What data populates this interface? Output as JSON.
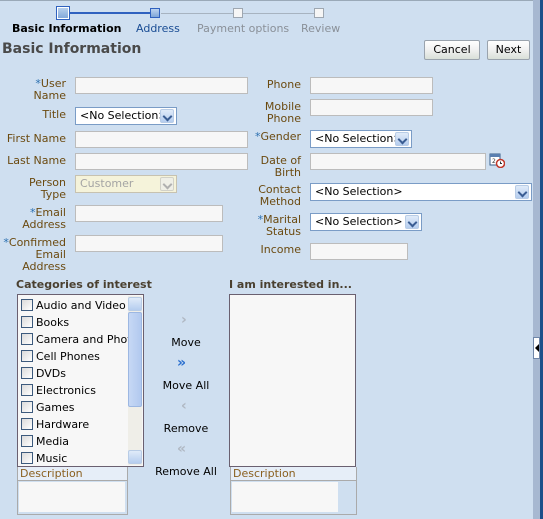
{
  "train": {
    "steps": [
      {
        "label": "Basic Information",
        "state": "current"
      },
      {
        "label": "Address",
        "state": "link"
      },
      {
        "label": "Payment options",
        "state": "disabled"
      },
      {
        "label": "Review",
        "state": "disabled"
      }
    ]
  },
  "page": {
    "title": "Basic Information",
    "cancel_label": "Cancel",
    "next_label": "Next"
  },
  "form": {
    "left": {
      "user_name": {
        "label_line1": "User",
        "label_line2": "Name",
        "required": "*",
        "value": ""
      },
      "title": {
        "label": "Title",
        "value": "<No Selection>"
      },
      "first_name": {
        "label": "First Name",
        "value": ""
      },
      "last_name": {
        "label": "Last Name",
        "value": ""
      },
      "person_type": {
        "label_line1": "Person",
        "label_line2": "Type",
        "value": "Customer"
      },
      "email": {
        "label_line1": "Email",
        "label_line2": "Address",
        "required": "*",
        "value": ""
      },
      "confirm_email": {
        "label_line1": "Confirmed",
        "label_line2": "Email",
        "label_line3": "Address",
        "required": "*",
        "value": ""
      }
    },
    "right": {
      "phone": {
        "label": "Phone",
        "value": ""
      },
      "mobile": {
        "label_line1": "Mobile",
        "label_line2": "Phone",
        "value": ""
      },
      "gender": {
        "label": "Gender",
        "required": "*",
        "value": "<No Selection>"
      },
      "dob": {
        "label_line1": "Date of",
        "label_line2": "Birth",
        "value": ""
      },
      "contact": {
        "label_line1": "Contact",
        "label_line2": "Method",
        "value": "<No Selection>"
      },
      "marital": {
        "label_line1": "Marital",
        "label_line2": "Status",
        "required": "*",
        "value": "<No Selection>"
      },
      "income": {
        "label": "Income",
        "value": ""
      }
    }
  },
  "shuttle": {
    "source_title": "Categories of interest",
    "target_title": "I am interested in...",
    "items": [
      "Audio and Video",
      "Books",
      "Camera and Photo",
      "Cell Phones",
      "DVDs",
      "Electronics",
      "Games",
      "Hardware",
      "Media",
      "Music"
    ],
    "description_label": "Description",
    "move": "Move",
    "move_all": "Move All",
    "remove": "Remove",
    "remove_all": "Remove All"
  }
}
